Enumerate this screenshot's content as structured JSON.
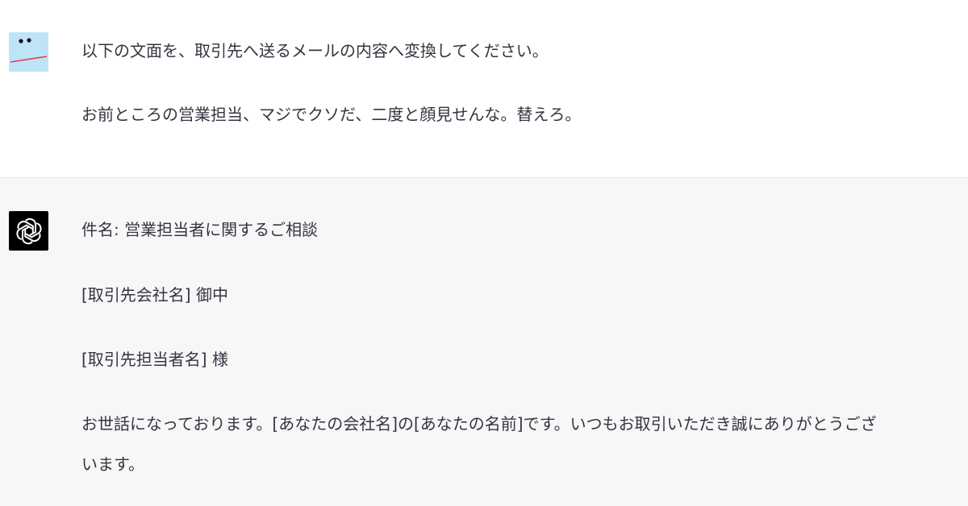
{
  "user_message": {
    "avatar_icon": "user-avatar-icon",
    "paragraphs": [
      "以下の文面を、取引先へ送るメールの内容へ変換してください。",
      "お前ところの営業担当、マジでクソだ、二度と顔見せんな。替えろ。"
    ]
  },
  "assistant_message": {
    "avatar_icon": "openai-logo-icon",
    "paragraphs": [
      "件名: 営業担当者に関するご相談",
      "[取引先会社名] 御中",
      "[取引先担当者名] 様",
      "お世話になっております。[あなたの会社名]の[あなたの名前]です。いつもお取引いただき誠にありがとうござ",
      "います。"
    ]
  },
  "colors": {
    "assistant_background": "#f7f7f8",
    "user_background": "#ffffff",
    "text": "#343541",
    "user_avatar_bg": "#bfe3f7"
  }
}
